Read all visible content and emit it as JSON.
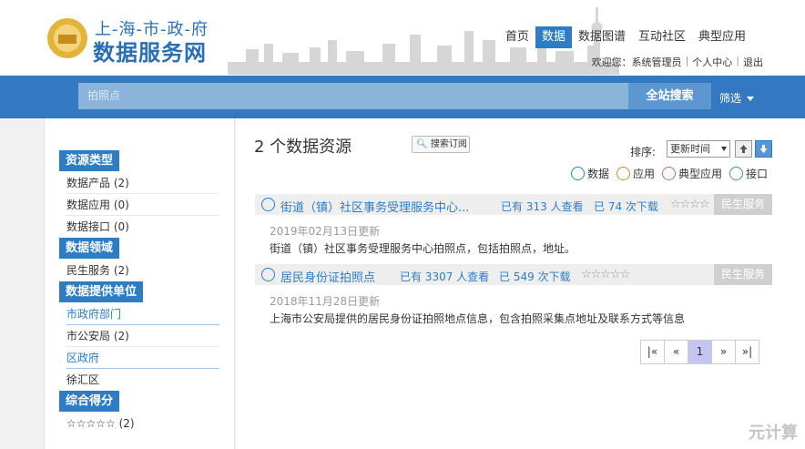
{
  "header": {
    "logo_top": "上-海-市-政-府",
    "logo_main": "数据服务网",
    "nav": [
      "首页",
      "数据",
      "数据图谱",
      "互动社区",
      "典型应用"
    ],
    "active_nav": 1,
    "user": {
      "welcome": "欢迎您：系统管理员",
      "personal": "个人中心",
      "logout": "退出"
    }
  },
  "search": {
    "placeholder": "拍照点",
    "button": "全站搜索",
    "filter": "筛选"
  },
  "sidebar": {
    "sections": [
      {
        "title": "资源类型",
        "items": [
          "数据产品 (2)",
          "数据应用 (0)",
          "数据接口 (0)"
        ]
      },
      {
        "title": "数据领域",
        "items": [
          "民生服务 (2)"
        ]
      },
      {
        "title": "数据提供单位",
        "items": [
          "市政府部门",
          "市公安局 (2)",
          "区政府",
          "徐汇区"
        ]
      },
      {
        "title": "综合得分",
        "items": [
          "☆☆☆☆☆ (2)"
        ]
      }
    ]
  },
  "main": {
    "result_count": "2 个数据资源",
    "subscribe": "搜索订阅",
    "sort_label": "排序:",
    "sort_value": "更新时间",
    "legend": [
      {
        "label": "数据",
        "color": "#2e7cc3"
      },
      {
        "label": "应用",
        "color": "#e0842f"
      },
      {
        "label": "典型应用",
        "color": "#b35fcf"
      },
      {
        "label": "接口",
        "color": "#45a04a"
      }
    ],
    "results": [
      {
        "title": "街道（镇）社区事务受理服务中心...",
        "views": "已有 313 人查看",
        "downloads": "已 74 次下载",
        "stars": "☆☆☆☆",
        "tag": "民生服务",
        "date": "2019年02月13日更新",
        "desc": "街道（镇）社区事务受理服务中心拍照点，包括拍照点，地址。"
      },
      {
        "title": "居民身份证拍照点",
        "views": "已有 3307 人查看",
        "downloads": "已 549 次下载",
        "stars": "☆☆☆☆☆",
        "tag": "民生服务",
        "date": "2018年11月28日更新",
        "desc": "上海市公安局提供的居民身份证拍照地点信息，包含拍照采集点地址及联系方式等信息"
      }
    ],
    "pager": [
      "|«",
      "«",
      "1",
      "»",
      "»|"
    ],
    "pager_active": 2
  },
  "watermark": "元计算"
}
